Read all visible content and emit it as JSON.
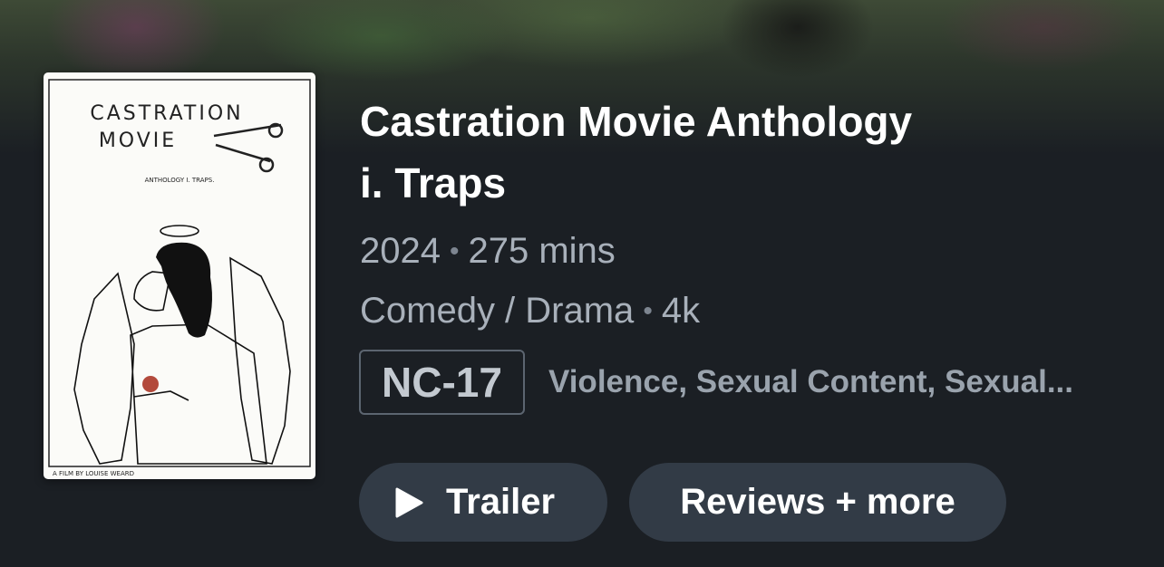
{
  "movie": {
    "title_line1": "Castration Movie Anthology",
    "title_line2": "i. Traps",
    "year": "2024",
    "runtime": "275 mins",
    "genres": "Comedy / Drama",
    "quality": "4k",
    "rating": "NC-17",
    "advisory": "Violence, Sexual Content, Sexual..."
  },
  "poster": {
    "title_line1": "CASTRATION",
    "title_line2": "MOVIE",
    "subtitle": "ANTHOLOGY I. TRAPS.",
    "credit": "A FILM BY LOUISE WEARD"
  },
  "actions": {
    "trailer_label": "Trailer",
    "reviews_label": "Reviews + more",
    "trailer_icon": "play-icon"
  },
  "colors": {
    "background": "#1b1f24",
    "button": "#323b46",
    "muted_text": "#a8b0ba"
  }
}
